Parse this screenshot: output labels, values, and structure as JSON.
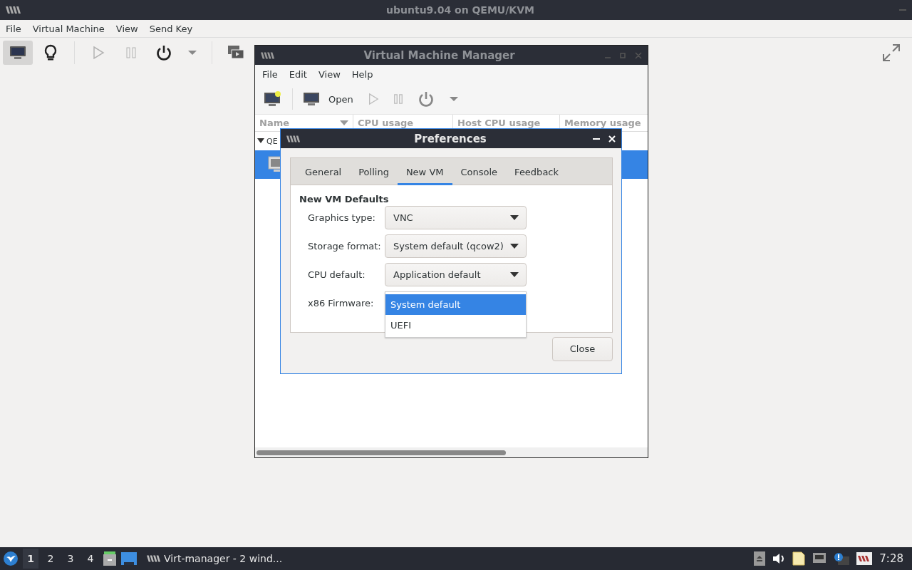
{
  "window": {
    "title": "ubuntu9.04 on QEMU/KVM"
  },
  "menu": [
    "File",
    "Virtual Machine",
    "View",
    "Send Key"
  ],
  "toolbar": [
    {
      "kind": "console",
      "selected": true,
      "disabled": false
    },
    {
      "kind": "details",
      "selected": false,
      "disabled": false
    },
    {
      "kind": "run",
      "selected": false,
      "disabled": true
    },
    {
      "kind": "pause",
      "selected": false,
      "disabled": true
    },
    {
      "kind": "power",
      "selected": false,
      "disabled": false
    },
    {
      "kind": "dropdown",
      "selected": false,
      "disabled": false
    },
    {
      "kind": "screenshot",
      "selected": false,
      "disabled": false
    }
  ],
  "manager": {
    "title": "Virtual Machine Manager",
    "menu": [
      "File",
      "Edit",
      "View",
      "Help"
    ],
    "toolbar": [
      {
        "kind": "new",
        "disabled": false
      },
      {
        "kind": "open",
        "label": "Open",
        "disabled": false
      },
      {
        "kind": "run",
        "disabled": true
      },
      {
        "kind": "pause",
        "disabled": true
      },
      {
        "kind": "power",
        "disabled": false
      },
      {
        "kind": "dropdown",
        "disabled": false
      }
    ],
    "columns": [
      "Name",
      "CPU usage",
      "Host CPU usage",
      "Memory usage"
    ],
    "rows": [
      {
        "kind": "group",
        "label": "QE",
        "expanded": true,
        "selected": false
      },
      {
        "kind": "vm",
        "selected": true
      }
    ]
  },
  "preferences": {
    "title": "Preferences",
    "tabs": [
      {
        "label": "General",
        "selected": false
      },
      {
        "label": "Polling",
        "selected": false
      },
      {
        "label": "New VM",
        "selected": true
      },
      {
        "label": "Console",
        "selected": false
      },
      {
        "label": "Feedback",
        "selected": false
      }
    ],
    "section": "New VM Defaults",
    "fields": [
      {
        "kind": "combo",
        "label": "Graphics type:",
        "value": "VNC"
      },
      {
        "kind": "combo",
        "label": "Storage format:",
        "value": "System default (qcow2)"
      },
      {
        "kind": "combo",
        "label": "CPU default:",
        "value": "Application default"
      },
      {
        "kind": "popup",
        "label": "x86 Firmware:",
        "options": [
          {
            "label": "System default",
            "selected": true
          },
          {
            "label": "UEFI",
            "selected": false
          }
        ]
      }
    ],
    "close_button": "Close"
  },
  "taskbar": {
    "workspaces": [
      {
        "label": "1",
        "selected": true
      },
      {
        "label": "2",
        "selected": false
      },
      {
        "label": "3",
        "selected": false
      },
      {
        "label": "4",
        "selected": false
      }
    ],
    "task": "Virt-manager - 2 wind...",
    "clock": "7:28"
  }
}
